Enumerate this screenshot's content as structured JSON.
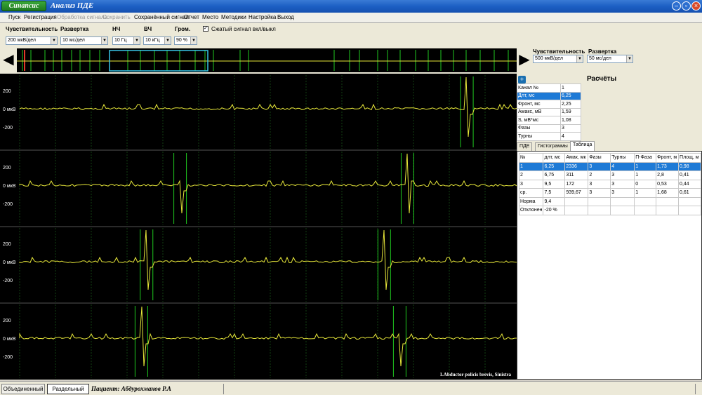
{
  "window": {
    "app_badge": "Синапсис",
    "title": "Анализ ПДЕ"
  },
  "menu": [
    "Пуск",
    "Регистрация",
    "Обработка сигнала",
    "Сохранить",
    "Сохранённый сигнал",
    "Отчет",
    "Место",
    "Методики",
    "Настройка",
    "Выход"
  ],
  "menu_disabled": [
    false,
    false,
    true,
    true,
    false,
    false,
    false,
    false,
    false,
    false
  ],
  "controls": {
    "sens_label": "Чувствительность",
    "sens_value": "200 мкВ/дел",
    "sweep_label": "Развертка",
    "sweep_value": "10 мс/дел",
    "lf_label": "НЧ",
    "lf_value": "10 Гц",
    "hf_label": "ВЧ",
    "hf_value": "10 кГц",
    "vol_label": "Гром.",
    "vol_value": "90 %",
    "compressed_label": "Сжатый сигнал вкл/выкл",
    "compressed_checked": true
  },
  "right_controls": {
    "sens_label": "Чувствительность",
    "sens_value": "500 мкВ/дел",
    "sweep_label": "Развертка",
    "sweep_value": "50 мс/дел"
  },
  "waveforms": {
    "channels": [
      {
        "ticks": [
          "200",
          "0 мкВ",
          "-200"
        ],
        "spikes": [
          0.905
        ]
      },
      {
        "ticks": [
          "200",
          "0 мкВ",
          "-200"
        ],
        "spikes": [
          0.35,
          0.79
        ]
      },
      {
        "ticks": [
          "200",
          "0 мкВ",
          "-200"
        ],
        "spikes": [
          0.285,
          0.745
        ]
      },
      {
        "ticks": [
          "200",
          "0 мкВ",
          "-200"
        ],
        "spikes": [
          0.275,
          0.775
        ]
      }
    ],
    "muscle": "1.Abductor policis brevis, Sinistra",
    "trace_color": "#e8e83a",
    "grid_color": "#1f6b1f",
    "marker_color": "#1fc81f"
  },
  "calc": {
    "title": "Расчёты",
    "rows": [
      {
        "k": "Канал №",
        "v": "1"
      },
      {
        "k": "Длт, мс",
        "v": "6,25"
      },
      {
        "k": "Фронт, мс",
        "v": "2,25"
      },
      {
        "k": "Амакс, мВ",
        "v": "1,59"
      },
      {
        "k": "S, мВ*мс",
        "v": "1,08"
      },
      {
        "k": "Фазы",
        "v": "3"
      },
      {
        "k": "Турны",
        "v": "4"
      }
    ],
    "selected_row": 1
  },
  "tabs": [
    "ПДЕ",
    "Гистограммы",
    "Таблица"
  ],
  "active_tab": 2,
  "results": {
    "headers": [
      "№",
      "длт, мс",
      "Амак, мк",
      "Фазы",
      "Турны",
      "П-Фаза",
      "Фронт, м",
      "Площ, м"
    ],
    "rows": [
      [
        "1",
        "6,25",
        "2336",
        "3",
        "4",
        "1",
        "1,73",
        "0,98"
      ],
      [
        "2",
        "6,75",
        "311",
        "2",
        "3",
        "1",
        "2,8",
        "0,41"
      ],
      [
        "3",
        "9,5",
        "172",
        "3",
        "3",
        "0",
        "0,53",
        "0,44"
      ],
      [
        "ср.",
        "7,5",
        "939,67",
        "3",
        "3",
        "1",
        "1,68",
        "0,61"
      ],
      [
        "Норма",
        "9,4",
        "",
        "",
        "",
        "",
        "",
        ""
      ],
      [
        "Отклонен",
        "-20 %",
        "",
        "",
        "",
        "",
        "",
        ""
      ]
    ],
    "selected_row": 0
  },
  "status": {
    "btn1": "Объединенный",
    "btn2": "Раздельный",
    "patient": "Пациент: Абдурохманов Р.А"
  }
}
